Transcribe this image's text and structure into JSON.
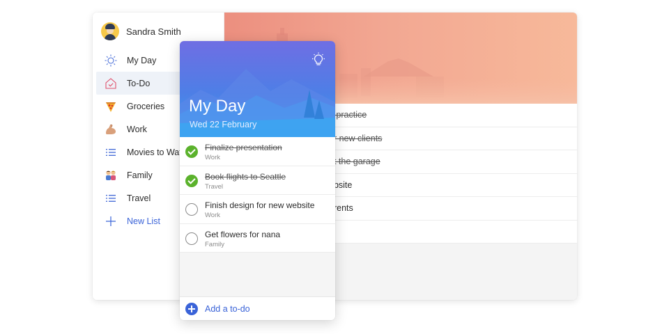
{
  "user": {
    "name": "Sandra Smith"
  },
  "sidebar": {
    "items": [
      {
        "label": "My Day",
        "icon": "sun-icon"
      },
      {
        "label": "To-Do",
        "icon": "home-icon",
        "active": true
      },
      {
        "label": "Groceries",
        "icon": "pizza-icon"
      },
      {
        "label": "Work",
        "icon": "flexed-arm-icon"
      },
      {
        "label": "Movies to Wat",
        "icon": "list-icon"
      },
      {
        "label": "Family",
        "icon": "family-icon"
      },
      {
        "label": "Travel",
        "icon": "list-icon"
      },
      {
        "label": "New List",
        "icon": "plus-icon"
      }
    ]
  },
  "background_list": {
    "tasks": [
      {
        "title": "o practice",
        "done": true
      },
      {
        "title": "or new clients",
        "done": true
      },
      {
        "title": "at the garage",
        "done": true
      },
      {
        "title": "ebsite",
        "done": false
      },
      {
        "title": "arents",
        "done": false
      },
      {
        "title": "",
        "done": false
      }
    ]
  },
  "card": {
    "title": "My Day",
    "date": "Wed 22 February",
    "tasks": [
      {
        "title": "Finalize presentation",
        "list": "Work",
        "done": true
      },
      {
        "title": "Book flights to Seattle",
        "list": "Travel",
        "done": true
      },
      {
        "title": "Finish design for new website",
        "list": "Work",
        "done": false
      },
      {
        "title": "Get flowers for nana",
        "list": "Family",
        "done": false
      }
    ],
    "add_label": "Add a to-do"
  },
  "colors": {
    "accent": "#3a63d8",
    "complete": "#5bb22c",
    "banner_start": "#ec8f7f",
    "banner_end": "#f7b99a",
    "card_header_top": "#6f6ee3",
    "card_header_bottom": "#3aa3f2"
  }
}
